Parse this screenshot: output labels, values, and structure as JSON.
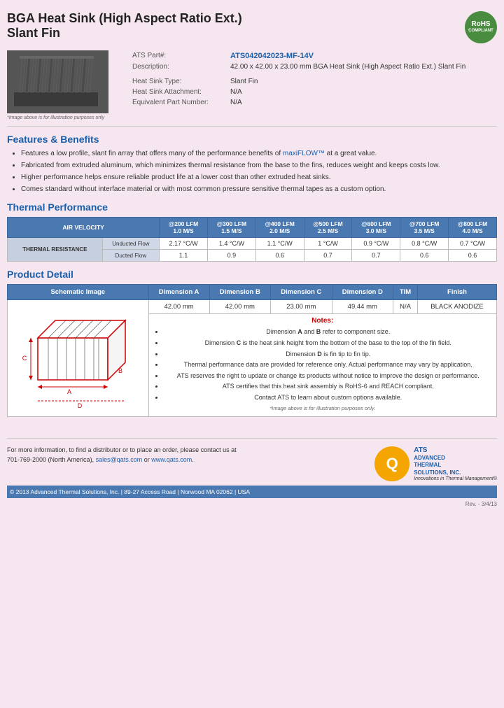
{
  "header": {
    "title_line1": "BGA Heat Sink (High Aspect Ratio Ext.)",
    "title_line2": "Slant Fin",
    "rohs": "RoHS\nCOMPLIANT"
  },
  "specs": {
    "part_label": "ATS Part#:",
    "part_number": "ATS042042023-MF-14V",
    "description_label": "Description:",
    "description": "42.00 x 42.00 x 23.00 mm  BGA Heat Sink (High Aspect Ratio Ext.) Slant Fin",
    "type_label": "Heat Sink Type:",
    "type_value": "Slant Fin",
    "attachment_label": "Heat Sink Attachment:",
    "attachment_value": "N/A",
    "equiv_label": "Equivalent Part Number:",
    "equiv_value": "N/A"
  },
  "image_caption": "*Image above is for illustration purposes only",
  "features": {
    "heading": "Features & Benefits",
    "items": [
      "Features a low profile, slant fin array that offers many of the performance benefits of maxiFLOW™ at a great value.",
      "Fabricated from extruded aluminum, which minimizes thermal resistance from the base to the fins, reduces weight and keeps costs low.",
      "Higher performance helps ensure reliable product life at a lower cost than other extruded heat sinks.",
      "Comes standard without interface material or with most common pressure sensitive thermal tapes as a custom option."
    ]
  },
  "thermal": {
    "heading": "Thermal Performance",
    "air_velocity_label": "AIR VELOCITY",
    "cols": [
      {
        "lfm": "@200 LFM",
        "ms": "1.0 M/S"
      },
      {
        "lfm": "@300 LFM",
        "ms": "1.5 M/S"
      },
      {
        "lfm": "@400 LFM",
        "ms": "2.0 M/S"
      },
      {
        "lfm": "@500 LFM",
        "ms": "2.5 M/S"
      },
      {
        "lfm": "@600 LFM",
        "ms": "3.0 M/S"
      },
      {
        "lfm": "@700 LFM",
        "ms": "3.5 M/S"
      },
      {
        "lfm": "@800 LFM",
        "ms": "4.0 M/S"
      }
    ],
    "row_label": "THERMAL RESISTANCE",
    "unducted_label": "Unducted Flow",
    "unducted_values": [
      "2.17 °C/W",
      "1.4 °C/W",
      "1.1 °C/W",
      "1 °C/W",
      "0.9 °C/W",
      "0.8 °C/W",
      "0.7 °C/W"
    ],
    "ducted_label": "Ducted Flow",
    "ducted_values": [
      "1.1",
      "0.9",
      "0.6",
      "0.7",
      "0.7",
      "0.6",
      "0.6"
    ]
  },
  "product_detail": {
    "heading": "Product Detail",
    "col_headers": [
      "Schematic Image",
      "Dimension A",
      "Dimension B",
      "Dimension C",
      "Dimension D",
      "TIM",
      "Finish"
    ],
    "dim_a": "42.00 mm",
    "dim_b": "42.00 mm",
    "dim_c": "23.00 mm",
    "dim_d": "49.44 mm",
    "tim": "N/A",
    "finish": "BLACK ANODIZE",
    "notes_heading": "Notes:",
    "notes": [
      "Dimension A and B refer to component size.",
      "Dimension C is the heat sink height from the bottom of the base to the top of the fin field.",
      "Dimension D is fin tip to fin tip.",
      "Thermal performance data are provided for reference only. Actual performance may vary by application.",
      "ATS reserves the right to update or change its products without notice to improve the design or performance.",
      "ATS certifies that this heat sink assembly is RoHS-6 and REACH compliant.",
      "Contact ATS to learn about custom options available."
    ],
    "image_note": "*Image above is for illustration purposes only."
  },
  "footer": {
    "contact_text": "For more information, to find a distributor or to place an order, please contact us at\n701-769-2000 (North America), sales@qats.com or www.qats.com.",
    "copyright": "© 2013 Advanced Thermal Solutions, Inc.  |  89-27 Access Road  |  Norwood MA   02062  |  USA",
    "logo_q": "Q",
    "logo_ats": "ATS",
    "logo_company": "ADVANCED\nTHERMAL\nSOLUTIONS, INC.",
    "logo_tagline": "Innovations in Thermal Management®",
    "rev": "Rev. - 3/4/13"
  }
}
